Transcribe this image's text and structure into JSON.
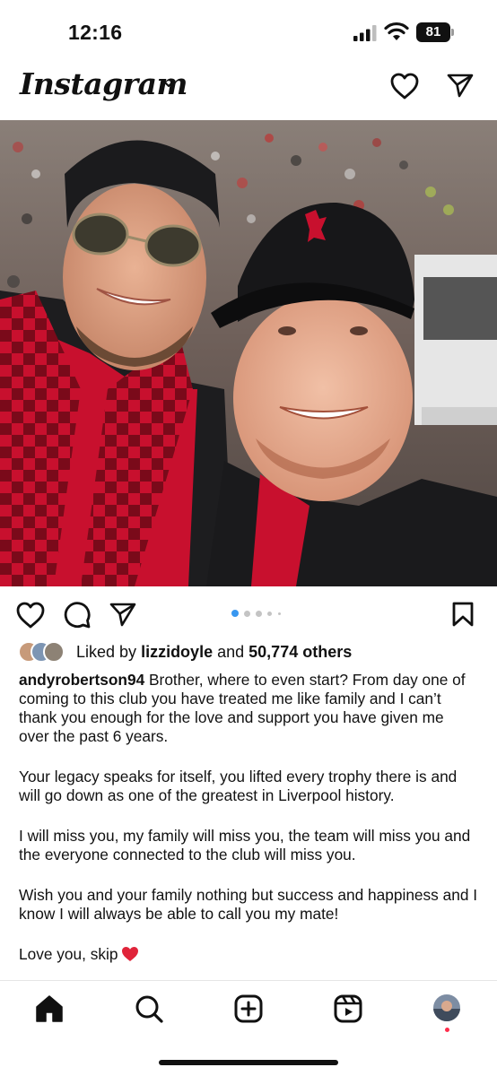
{
  "status_bar": {
    "time": "12:16",
    "battery_level": "81",
    "icons": [
      "signal-icon",
      "wifi-icon",
      "battery-icon"
    ]
  },
  "header": {
    "logo_text": "Instagram",
    "icons": [
      "chevron-down-icon",
      "heart-icon",
      "send-icon"
    ]
  },
  "post": {
    "image": {
      "subject": "photo",
      "carousel_total": 5,
      "carousel_active_index": 1
    },
    "actions": {
      "icons": [
        "heart-icon",
        "comment-icon",
        "share-icon",
        "bookmark-icon"
      ]
    },
    "likes": {
      "prefix": "Liked by",
      "first_user": "lizzidoyle",
      "middle": "and",
      "count_text": "50,774 others"
    },
    "caption": {
      "username": "andyrobertson94",
      "paragraphs": [
        "Brother, where to even start? From day one of coming to this club you have treated me like family and I can’t thank you enough for the love and support you have given me over the past 6 years.",
        "Your legacy speaks for itself, you lifted every trophy there is and will go down as one of the greatest in Liverpool history.",
        "I will miss you, my family will miss you, the team will miss you and the everyone connected to the club will miss you.",
        "Wish you and your family nothing but success and happiness and I know I will always be able to call you my mate!",
        "Love you, skip"
      ],
      "emoji": "red-heart"
    }
  },
  "bottom_nav": {
    "items": [
      "home-icon",
      "search-icon",
      "create-icon",
      "reels-icon",
      "profile-avatar"
    ],
    "active": "home-icon"
  },
  "colors": {
    "accent_blue": "#3897f0",
    "heart_red": "#e0243a",
    "notification_red": "#ff2d4b",
    "liverpool_red": "#c8102e"
  }
}
